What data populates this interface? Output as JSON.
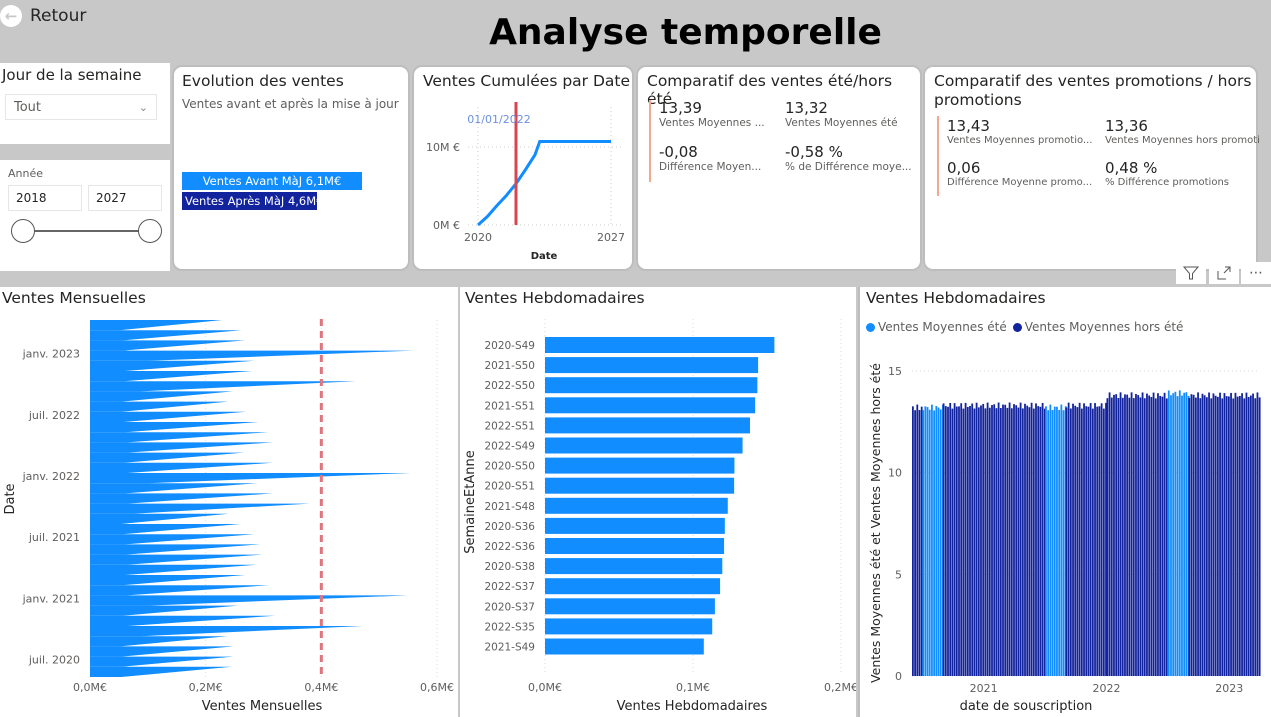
{
  "header": {
    "back_label": "Retour",
    "title": "Analyse temporelle"
  },
  "slicers": {
    "weekday": {
      "title": "Jour de la semaine",
      "selected": "Tout"
    },
    "year": {
      "title": "Année",
      "from": "2018",
      "to": "2027",
      "range": [
        2018,
        2027
      ]
    }
  },
  "evolution": {
    "title": "Evolution des ventes",
    "subtitle": "Ventes avant et après la mise à jour",
    "bars": [
      {
        "label": "Ventes Avant MàJ 6,1M€",
        "value": 6.1,
        "color": "#118dff"
      },
      {
        "label": "Ventes Après MàJ 4,6M€",
        "value": 4.6,
        "color": "#12239e"
      }
    ]
  },
  "cumul": {
    "title": "Ventes Cumulées par Date",
    "marker_label": "01/01/2022",
    "y_ticks": [
      "10M €",
      "0M €"
    ],
    "x_ticks": [
      "2020",
      "2027"
    ],
    "x_label": "Date"
  },
  "summer": {
    "title": "Comparatif des ventes été/hors été",
    "kpis": [
      {
        "value": "13,39",
        "label": "Ventes Moyennes ..."
      },
      {
        "value": "13,32",
        "label": "Ventes Moyennes été"
      },
      {
        "value": "-0,08",
        "label": "Différence Moyen..."
      },
      {
        "value": "-0,58 %",
        "label": "% de Différence moye..."
      }
    ]
  },
  "promo": {
    "title": "Comparatif des ventes promotions / hors promotions",
    "kpis": [
      {
        "value": "13,43",
        "label": "Ventes Moyennes promotio..."
      },
      {
        "value": "13,36",
        "label": "Ventes Moyennes hors promoti..."
      },
      {
        "value": "0,06",
        "label": "Différence Moyenne promo..."
      },
      {
        "value": "0,48 %",
        "label": "% Différence promotions"
      }
    ]
  },
  "visual_header_icons": [
    "filter-icon",
    "focus-mode-icon",
    "more-options-icon"
  ],
  "chart_data": [
    {
      "type": "line",
      "title": "Ventes Cumulées par Date",
      "xlabel": "Date",
      "ylabel": "",
      "x": [
        2020.0,
        2020.5,
        2021.0,
        2021.5,
        2022.0,
        2022.5,
        2023.0,
        2023.25,
        2024,
        2025,
        2026,
        2027
      ],
      "values": [
        0,
        1.1,
        2.5,
        3.8,
        5.3,
        7.1,
        9.0,
        10.7,
        10.7,
        10.7,
        10.7,
        10.7
      ],
      "xlim": [
        2020,
        2027
      ],
      "ylim": [
        0,
        14
      ],
      "y_unit": "M €",
      "reference_line": {
        "x": 2022.0,
        "label": "01/01/2022",
        "color": "#d64550"
      }
    },
    {
      "type": "bar",
      "title": "Ventes Mensuelles",
      "orientation": "horizontal",
      "xlabel": "Ventes Mensuelles",
      "ylabel": "Date",
      "x_ticks": [
        "0,0M€",
        "0,2M€",
        "0,4M€",
        "0,6M€"
      ],
      "xlim": [
        0,
        0.6
      ],
      "y_ticks": [
        "janv. 2023",
        "juil. 2022",
        "janv. 2022",
        "juil. 2021",
        "janv. 2021",
        "juil. 2020"
      ],
      "reference_line": {
        "value": 0.4,
        "style": "dashed",
        "color": "#e0767d"
      },
      "categories_desc": [
        "2023-04",
        "2023-03",
        "2023-02",
        "2023-01",
        "2022-12",
        "2022-11",
        "2022-10",
        "2022-09",
        "2022-08",
        "2022-07",
        "2022-06",
        "2022-05",
        "2022-04",
        "2022-03",
        "2022-02",
        "2022-01",
        "2021-12",
        "2021-11",
        "2021-10",
        "2021-09",
        "2021-08",
        "2021-07",
        "2021-06",
        "2021-05",
        "2021-04",
        "2021-03",
        "2021-02",
        "2021-01",
        "2020-12",
        "2020-11",
        "2020-10",
        "2020-09",
        "2020-08",
        "2020-07",
        "2020-06"
      ],
      "values": [
        0.229,
        0.262,
        0.268,
        0.559,
        0.284,
        0.28,
        0.46,
        0.247,
        0.239,
        0.27,
        0.291,
        0.308,
        0.316,
        0.266,
        0.316,
        0.555,
        0.29,
        0.316,
        0.38,
        0.24,
        0.26,
        0.284,
        0.294,
        0.298,
        0.287,
        0.268,
        0.31,
        0.55,
        0.256,
        0.32,
        0.472,
        0.237,
        0.248,
        0.248,
        0.245
      ]
    },
    {
      "type": "bar",
      "title": "Ventes Hebdomadaires",
      "orientation": "horizontal",
      "xlabel": "Ventes Hebdomadaires",
      "ylabel": "SemaineEtAnne",
      "x_ticks": [
        "0,0M€",
        "0,1M€",
        "0,2M€"
      ],
      "xlim": [
        0,
        0.2
      ],
      "categories": [
        "2020-S49",
        "2021-S50",
        "2022-S50",
        "2021-S51",
        "2022-S51",
        "2022-S49",
        "2020-S50",
        "2020-S51",
        "2021-S48",
        "2020-S36",
        "2022-S36",
        "2020-S38",
        "2022-S37",
        "2020-S37",
        "2022-S35",
        "2021-S49"
      ],
      "values": [
        0.155,
        0.144,
        0.1435,
        0.142,
        0.1385,
        0.1335,
        0.128,
        0.1278,
        0.1235,
        0.1215,
        0.121,
        0.1198,
        0.1183,
        0.1148,
        0.113,
        0.1073
      ],
      "color": "#118dff"
    },
    {
      "type": "bar",
      "title": "Ventes Hebdomadaires",
      "xlabel": "date de souscription",
      "ylabel": "Ventes Moyennes été et Ventes Moyennes hors été",
      "y_ticks": [
        "0",
        "5",
        "10",
        "15"
      ],
      "ylim": [
        0,
        16
      ],
      "x_ticks": [
        "2021",
        "2022",
        "2023"
      ],
      "legend": [
        {
          "name": "Ventes Moyennes été",
          "color": "#118dff"
        },
        {
          "name": "Ventes Moyennes hors été",
          "color": "#12239e"
        }
      ],
      "legend_position": "top-left",
      "segments": [
        {
          "from": "2020-06",
          "to": "2020-07",
          "series": "Ventes Moyennes hors été",
          "level": 13.2
        },
        {
          "from": "2020-07",
          "to": "2020-09",
          "series": "Ventes Moyennes été",
          "level": 13.2
        },
        {
          "from": "2020-09",
          "to": "2021-07",
          "series": "Ventes Moyennes hors été",
          "level": 13.3
        },
        {
          "from": "2021-07",
          "to": "2021-09",
          "series": "Ventes Moyennes été",
          "level": 13.2
        },
        {
          "from": "2021-09",
          "to": "2022-01",
          "series": "Ventes Moyennes hors été",
          "level": 13.3
        },
        {
          "from": "2022-01",
          "to": "2022-07",
          "series": "Ventes Moyennes hors été",
          "level": 13.8
        },
        {
          "from": "2022-07",
          "to": "2022-09",
          "series": "Ventes Moyennes été",
          "level": 13.9
        },
        {
          "from": "2022-09",
          "to": "2023-04",
          "series": "Ventes Moyennes hors été",
          "level": 13.8
        }
      ]
    }
  ]
}
